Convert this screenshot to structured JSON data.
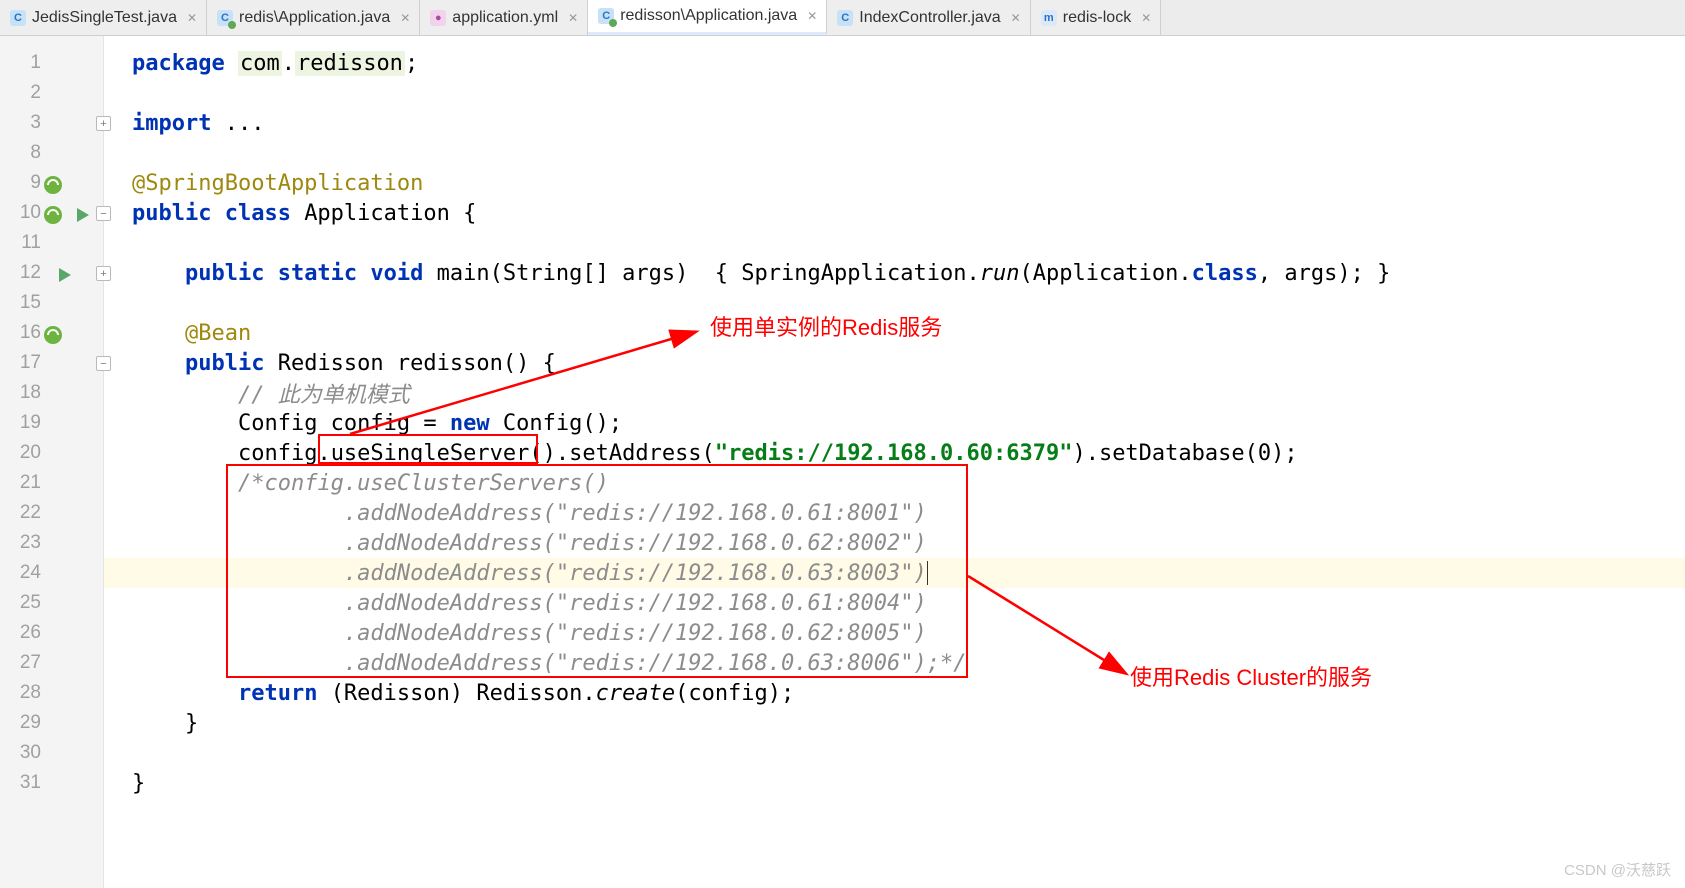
{
  "tabs": [
    {
      "label": "JedisSingleTest.java",
      "ico": "C",
      "icoClass": "c"
    },
    {
      "label": "redis\\Application.java",
      "ico": "C",
      "icoClass": "cg"
    },
    {
      "label": "application.yml",
      "ico": "Y",
      "icoClass": "y"
    },
    {
      "label": "redisson\\Application.java",
      "ico": "C",
      "icoClass": "cg",
      "active": true
    },
    {
      "label": "IndexController.java",
      "ico": "C",
      "icoClass": "c"
    },
    {
      "label": "redis-lock",
      "ico": "m",
      "icoClass": "m"
    }
  ],
  "line_numbers": [
    "1",
    "2",
    "3",
    "8",
    "9",
    "10",
    "11",
    "12",
    "15",
    "16",
    "17",
    "18",
    "19",
    "20",
    "21",
    "22",
    "23",
    "24",
    "25",
    "26",
    "27",
    "28",
    "29",
    "30",
    "31"
  ],
  "code": {
    "l1": {
      "kw": "package ",
      "pkg1": "com",
      "dot1": ".",
      "pkg2": "redisson",
      "semi": ";"
    },
    "l3": {
      "kw": "import ",
      "rest": "..."
    },
    "l9": {
      "ann": "@SpringBootApplication"
    },
    "l10": {
      "kw": "public class ",
      "name": "Application ",
      "brace": "{"
    },
    "l12": {
      "indent": "    ",
      "kw1": "public static void ",
      "m": "main",
      "p1": "(String[] args)  { SpringApplication.",
      "run": "run",
      "p2": "(Application.",
      "cls": "class",
      "p3": ", args); }"
    },
    "l16": {
      "indent": "    ",
      "ann": "@Bean"
    },
    "l17": {
      "indent": "    ",
      "kw": "public ",
      "ret": "Redisson ",
      "m": "redisson",
      "rest": "() {"
    },
    "l18": {
      "indent": "        ",
      "c": "// 此为单机模式"
    },
    "l19": {
      "indent": "        ",
      "t1": "Config config = ",
      "kw": "new ",
      "t2": "Config();"
    },
    "l20": {
      "indent": "        ",
      "t1": "config.",
      "m1": "useSingleServer()",
      "t2": ".setAddress(",
      "q1": "\"",
      "url": "redis://192.168.0.60:6379",
      "q2": "\"",
      "t3": ").setDatabase(",
      "n": "0",
      "t4": ");"
    },
    "l21": {
      "indent": "        ",
      "c": "/*config.useClusterServers()"
    },
    "l22": {
      "indent": "                ",
      "c": ".addNodeAddress(\"redis://192.168.0.61:8001\")"
    },
    "l23": {
      "indent": "                ",
      "c": ".addNodeAddress(\"redis://192.168.0.62:8002\")"
    },
    "l24": {
      "indent": "                ",
      "c": ".addNodeAddress(\"redis://192.168.0.63:8003\")"
    },
    "l25": {
      "indent": "                ",
      "c": ".addNodeAddress(\"redis://192.168.0.61:8004\")"
    },
    "l26": {
      "indent": "                ",
      "c": ".addNodeAddress(\"redis://192.168.0.62:8005\")"
    },
    "l27": {
      "indent": "                ",
      "c": ".addNodeAddress(\"redis://192.168.0.63:8006\");*/"
    },
    "l28": {
      "indent": "        ",
      "kw": "return ",
      "t1": "(Redisson) Redisson.",
      "m": "create",
      "t2": "(config);"
    },
    "l29": {
      "indent": "    ",
      "brace": "}"
    },
    "l31": {
      "brace": "}"
    }
  },
  "annotations": {
    "label_single": "使用单实例的Redis服务",
    "label_cluster": "使用Redis Cluster的服务"
  },
  "watermark": "CSDN @沃慈跃"
}
